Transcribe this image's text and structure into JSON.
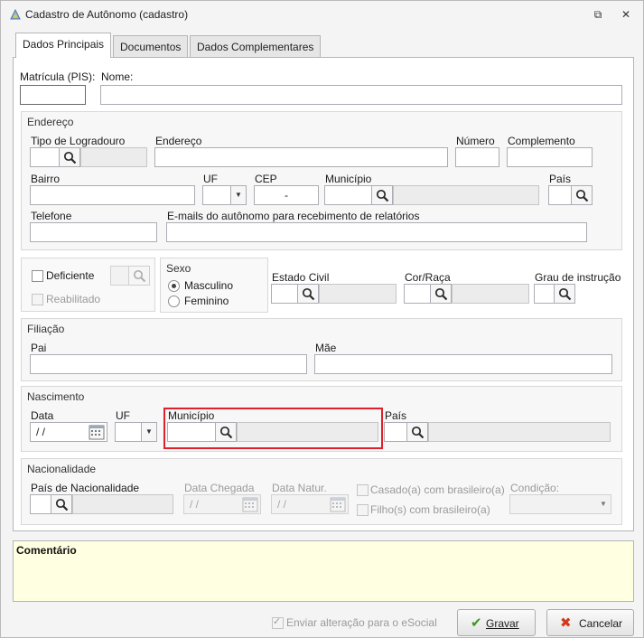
{
  "window": {
    "title": "Cadastro de Autônomo (cadastro)",
    "restore_glyph": "⧉",
    "close_glyph": "✕"
  },
  "tabs": [
    {
      "label": "Dados Principais",
      "active": true
    },
    {
      "label": "Documentos",
      "active": false
    },
    {
      "label": "Dados Complementares",
      "active": false
    }
  ],
  "form": {
    "matricula_label": "Matrícula (PIS):",
    "nome_label": "Nome:",
    "endereco": {
      "title": "Endereço",
      "tipo_logradouro_label": "Tipo de Logradouro",
      "endereco_label": "Endereço",
      "numero_label": "Número",
      "complemento_label": "Complemento",
      "bairro_label": "Bairro",
      "uf_label": "UF",
      "cep_label": "CEP",
      "cep_value": "-",
      "municipio_label": "Município",
      "pais_label": "País",
      "telefone_label": "Telefone",
      "emails_label": "E-mails do autônomo para recebimento de relatórios"
    },
    "deficiente_label": "Deficiente",
    "reabilitado_label": "Reabilitado",
    "sexo": {
      "title": "Sexo",
      "masculino": "Masculino",
      "feminino": "Feminino",
      "selected": "Masculino"
    },
    "estado_civil_label": "Estado Civil",
    "cor_raca_label": "Cor/Raça",
    "grau_instrucao_label": "Grau de instrução",
    "filiacao": {
      "title": "Filiação",
      "pai_label": "Pai",
      "mae_label": "Mãe"
    },
    "nascimento": {
      "title": "Nascimento",
      "data_label": "Data",
      "data_value": "/ /",
      "uf_label": "UF",
      "municipio_label": "Município",
      "pais_label": "País"
    },
    "nacionalidade": {
      "title": "Nacionalidade",
      "pais_label": "País de Nacionalidade",
      "data_chegada_label": "Data Chegada",
      "data_chegada_value": "/ /",
      "data_natur_label": "Data Natur.",
      "data_natur_value": "/ /",
      "casado_label": "Casado(a) com brasileiro(a)",
      "filhos_label": "Filho(s) com brasileiro(a)",
      "condicao_label": "Condição:"
    }
  },
  "comentario_label": "Comentário",
  "footer": {
    "enviar_label": "Enviar alteração para o eSocial",
    "gravar_label": "Gravar",
    "cancelar_label": "Cancelar"
  },
  "colors": {
    "highlight": "#e0202a",
    "comment_bg": "#ffffe1",
    "gravar_icon": "#3a9a1a",
    "cancelar_icon": "#d23a1a"
  },
  "icons": [
    "app-icon",
    "search-icon",
    "calendar-icon",
    "chevron-down-icon",
    "check-icon",
    "x-icon"
  ]
}
